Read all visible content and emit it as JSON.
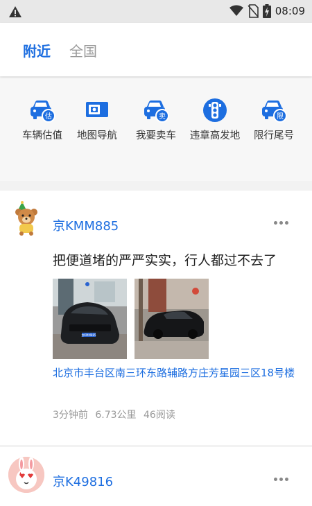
{
  "status_bar": {
    "time": "08:09"
  },
  "tabs": [
    {
      "label": "附近"
    },
    {
      "label": "全国"
    }
  ],
  "quick_actions": [
    {
      "label": "车辆估值",
      "icon": "car-valuation-icon",
      "badge": "估"
    },
    {
      "label": "地图导航",
      "icon": "map-camera-icon"
    },
    {
      "label": "我要卖车",
      "icon": "sell-car-icon",
      "badge": "卖"
    },
    {
      "label": "违章高发地",
      "icon": "traffic-light-icon"
    },
    {
      "label": "限行尾号",
      "icon": "restriction-car-icon",
      "badge": "限"
    }
  ],
  "posts": [
    {
      "plate": "京KMM885",
      "text": "把便道堵的严严实实，行人都过不去了",
      "photo_plate_text": "京KMM885",
      "address": "北京市丰台区南三环东路辅路方庄芳星园三区18号楼",
      "time_ago": "3分钟前",
      "distance": "6.73公里",
      "reads": "46阅读"
    },
    {
      "plate": "京K49816"
    }
  ],
  "colors": {
    "accent": "#1d6ee0",
    "status_bar": "#e8e8e8",
    "background": "#f2f2f2"
  }
}
